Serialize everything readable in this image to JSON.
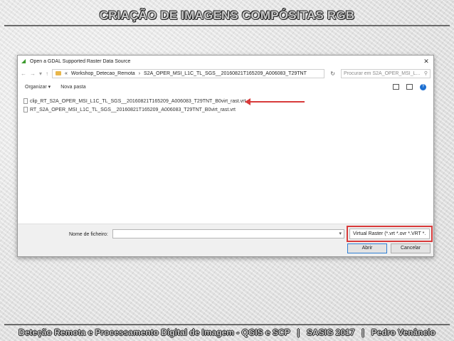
{
  "slide": {
    "title": "CRIAÇÃO DE IMAGENS COMPÓSITAS RGB",
    "footer": {
      "course": "Deteção Remota e Processamento Digital de Imagem - QGIS e SCP",
      "sep1": "|",
      "event": "SASIG 2017",
      "sep2": "|",
      "author": "Pedro Venâncio"
    }
  },
  "dialog": {
    "title": "Open a GDAL Supported Raster Data Source",
    "close": "✕",
    "nav": {
      "back": "←",
      "forward": "→",
      "up": "↑",
      "dropdown": "▾"
    },
    "path": {
      "prefix": "«",
      "seg1": "Workshop_Detecao_Remota",
      "arrow": "›",
      "seg2": "S2A_OPER_MSI_L1C_TL_SGS__20160821T165209_A006083_T29TNT"
    },
    "refresh": "↻",
    "search_placeholder": "Procurar em S2A_OPER_MSI_L...",
    "search_icon": "⚲",
    "toolbar": {
      "organize": "Organizar ▾",
      "new_folder": "Nova pasta",
      "help": "?"
    },
    "files": [
      "clip_RT_S2A_OPER_MSI_L1C_TL_SGS__20160821T165209_A006083_T29TNT_B0virt_rast.vrt",
      "RT_S2A_OPER_MSI_L1C_TL_SGS__20160821T165209_A006083_T29TNT_B0virt_rast.vrt"
    ],
    "filename_label": "Nome de ficheiro:",
    "filename_value": "",
    "filename_dropdown": "▾",
    "filter_value": "Virtual Raster (*.vrt *.ovr *.VRT *.",
    "open_button": "Abrir",
    "cancel_button": "Cancelar"
  },
  "colors": {
    "accent_red": "#d83a3a",
    "qgis_green": "#3c9a2d"
  }
}
